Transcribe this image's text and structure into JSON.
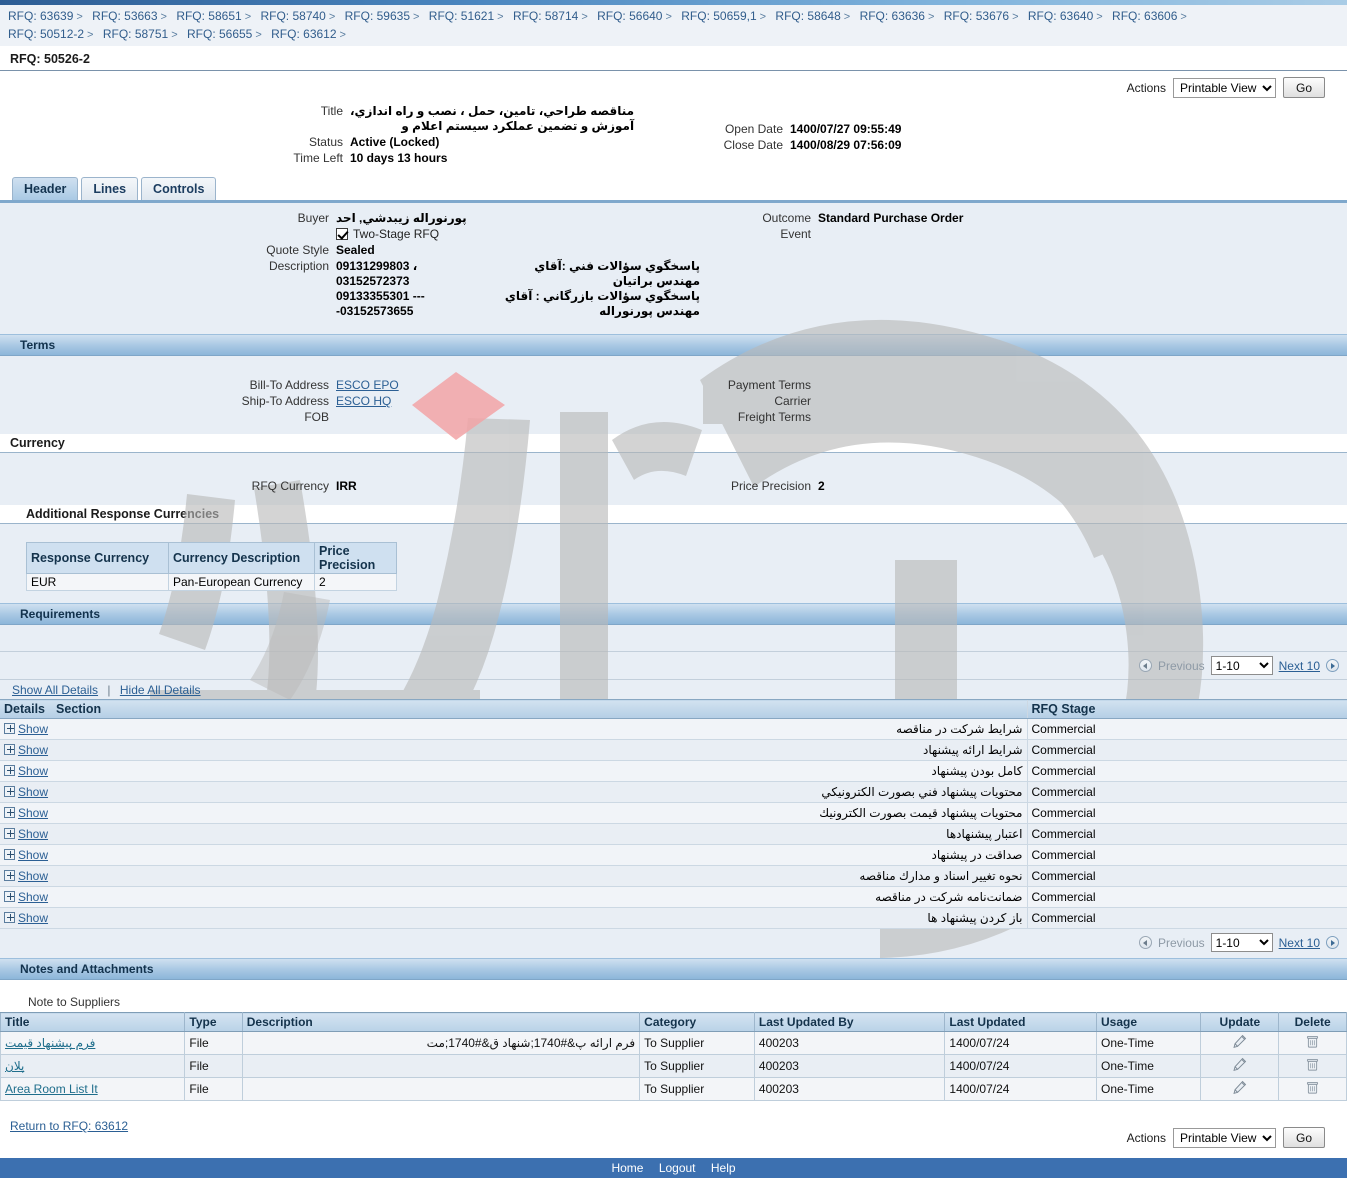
{
  "breadcrumb": {
    "items": [
      "RFQ: 63639",
      "RFQ: 53663",
      "RFQ: 58651",
      "RFQ: 58740",
      "RFQ: 59635",
      "RFQ: 51621",
      "RFQ: 58714",
      "RFQ: 56640",
      "RFQ: 50659,1",
      "RFQ: 58648",
      "RFQ: 63636",
      "RFQ: 53676",
      "RFQ: 63640",
      "RFQ: 63606",
      "RFQ: 50512-2",
      "RFQ: 58751",
      "RFQ: 56655",
      "RFQ: 63612"
    ],
    "separator": ">",
    "current": "RFQ: 50526-2"
  },
  "toolbar_top": {
    "actions_label": "Actions",
    "action_selected": "Printable View",
    "action_options": [
      "Printable View"
    ],
    "go_label": "Go"
  },
  "toolbar_bottom": {
    "actions_label": "Actions",
    "action_selected": "Printable View",
    "action_options": [
      "Printable View"
    ],
    "go_label": "Go"
  },
  "summary": {
    "title_label": "Title",
    "title_line1": "مناقصه طراحي، تامين، حمل ، نصب و راه اندازي،",
    "title_line2": "آموزش و تضمين عملكرد سيستم اعلام و",
    "status_label": "Status",
    "status_value": "Active (Locked)",
    "time_left_label": "Time Left",
    "time_left_value": "10 days 13 hours",
    "open_date_label": "Open Date",
    "open_date_value": "1400/07/27 09:55:49",
    "close_date_label": "Close Date",
    "close_date_value": "1400/08/29 07:56:09"
  },
  "tabs": [
    {
      "label": "Header",
      "active": true
    },
    {
      "label": "Lines",
      "active": false
    },
    {
      "label": "Controls",
      "active": false
    }
  ],
  "header_section": {
    "buyer_label": "Buyer",
    "buyer_value": "پورنوراله زيبدشي, احد",
    "two_stage_label": "Two-Stage RFQ",
    "two_stage_checked": true,
    "quote_style_label": "Quote Style",
    "quote_style_value": "Sealed",
    "description_label": "Description",
    "description_line1_left": "09131299803 ، 03152572373",
    "description_line1_right": "پاسخگوي سؤالات فني :آقاي مهندس براتيان",
    "description_line2_left": "09133355301 ----03152573655",
    "description_line2_right": "پاسخگوي سؤالات بازرگاني :  آقاي مهندس  پورنوراله",
    "outcome_label": "Outcome",
    "outcome_value": "Standard Purchase Order",
    "event_label": "Event",
    "event_value": ""
  },
  "terms": {
    "heading": "Terms",
    "bill_to_label": "Bill-To Address",
    "bill_to_value": "ESCO EPO",
    "ship_to_label": "Ship-To Address",
    "ship_to_value": "ESCO HQ",
    "fob_label": "FOB",
    "fob_value": "",
    "payment_terms_label": "Payment Terms",
    "payment_terms_value": "",
    "carrier_label": "Carrier",
    "carrier_value": "",
    "freight_terms_label": "Freight Terms",
    "freight_terms_value": ""
  },
  "currency": {
    "heading": "Currency",
    "rfq_currency_label": "RFQ Currency",
    "rfq_currency_value": "IRR",
    "price_precision_label": "Price Precision",
    "price_precision_value": "2",
    "additional_heading": "Additional Response Currencies",
    "table": {
      "columns": [
        "Response Currency",
        "Currency Description",
        "Price Precision"
      ],
      "rows": [
        [
          "EUR",
          "Pan-European Currency",
          "2"
        ]
      ]
    }
  },
  "requirements": {
    "heading": "Requirements",
    "show_all_label": "Show All Details",
    "hide_all_label": "Hide All Details",
    "separator": "|",
    "pager": {
      "previous_label": "Previous",
      "range_selected": "1-10",
      "range_options": [
        "1-10"
      ],
      "next_label": "Next 10"
    },
    "columns": [
      "Details",
      "Section",
      "RFQ Stage"
    ],
    "show_link_label": "Show",
    "rows": [
      {
        "section": "شرايط شركت در مناقصه",
        "stage": "Commercial"
      },
      {
        "section": "شرايط ارائه پيشنهاد",
        "stage": "Commercial"
      },
      {
        "section": "كامل بودن پيشنهاد",
        "stage": "Commercial"
      },
      {
        "section": "محتويات پيشنهاد فني بصورت الكترونيكي",
        "stage": "Commercial"
      },
      {
        "section": "محتويات پيشنهاد قيمت بصورت الكترونيك",
        "stage": "Commercial"
      },
      {
        "section": "اعتبار پيشنهادها",
        "stage": "Commercial"
      },
      {
        "section": "صداقت در پيشنهاد",
        "stage": "Commercial"
      },
      {
        "section": "نحوه تغيير اسناد و مدارك مناقصه",
        "stage": "Commercial"
      },
      {
        "section": "ضمانت‌نامه شركت در مناقصه",
        "stage": "Commercial"
      },
      {
        "section": "باز كردن پيشنهاد ها",
        "stage": "Commercial"
      }
    ]
  },
  "notes": {
    "heading": "Notes and Attachments",
    "note_to_suppliers_label": "Note to Suppliers",
    "columns": [
      "Title",
      "Type",
      "Description",
      "Category",
      "Last Updated By",
      "Last Updated",
      "Usage",
      "Update",
      "Delete"
    ],
    "rows": [
      {
        "title": "فرم پيشنهاد قيمت",
        "type": "File",
        "description": "فرم ارائه پ&#1740;شنهاد ق&#1740;مت",
        "category": "To Supplier",
        "last_updated_by": "400203",
        "last_updated": "1400/07/24",
        "usage": "One-Time",
        "update_icon": "pencil-icon",
        "delete_icon": "trash-icon"
      },
      {
        "title": "پلان",
        "type": "File",
        "description": "",
        "category": "To Supplier",
        "last_updated_by": "400203",
        "last_updated": "1400/07/24",
        "usage": "One-Time",
        "update_icon": "pencil-icon",
        "delete_icon": "trash-icon"
      },
      {
        "title": "Area Room List It",
        "type": "File",
        "description": "",
        "category": "To Supplier",
        "last_updated_by": "400203",
        "last_updated": "1400/07/24",
        "usage": "One-Time",
        "update_icon": "pencil-icon",
        "delete_icon": "trash-icon"
      }
    ]
  },
  "return_link": "Return to RFQ: 63612",
  "footer": {
    "links": [
      "Home",
      "Logout",
      "Help"
    ]
  },
  "colors": {
    "accent_blue": "#3c70b0",
    "band_blue": "#8cb6da",
    "panel_bg": "#e8eef5",
    "link": "#2b5f94",
    "watermark_gray": "#b8b8b8",
    "watermark_red": "#f0a0a0"
  }
}
